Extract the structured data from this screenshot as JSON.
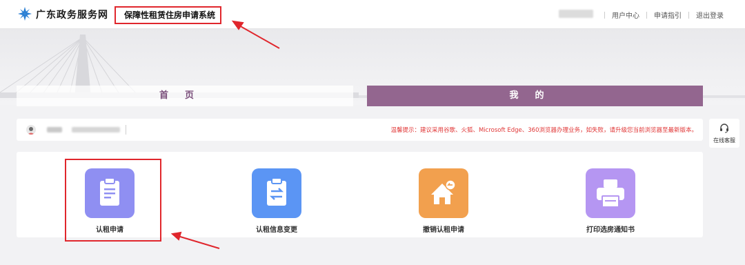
{
  "header": {
    "site_name": "广东政务服务网",
    "system_title": "保障性租赁住房申请系统",
    "links": [
      "用户中心",
      "申请指引",
      "退出登录"
    ]
  },
  "tabs": [
    {
      "label": "首页"
    },
    {
      "label": "我的"
    }
  ],
  "info_bar": {
    "notice": "温馨提示：建议采用谷歌、火狐、Microsoft Edge、360浏览器办理业务，如失败，请升级您当前浏览器至最新版本。"
  },
  "service": {
    "label": "在线客服"
  },
  "cards": [
    {
      "label": "认租申请",
      "icon": "clipboard-icon",
      "color": "#8f8ff2"
    },
    {
      "label": "认租信息变更",
      "icon": "swap-clipboard-icon",
      "color": "#5b95f4"
    },
    {
      "label": "撤销认租申请",
      "icon": "house-undo-icon",
      "color": "#f2a04e"
    },
    {
      "label": "打印选房通知书",
      "icon": "printer-icon",
      "color": "#b596f2"
    }
  ],
  "colors": {
    "accent_purple": "#93668f",
    "annotation_red": "#e0262c",
    "notice_red": "#e03535"
  }
}
